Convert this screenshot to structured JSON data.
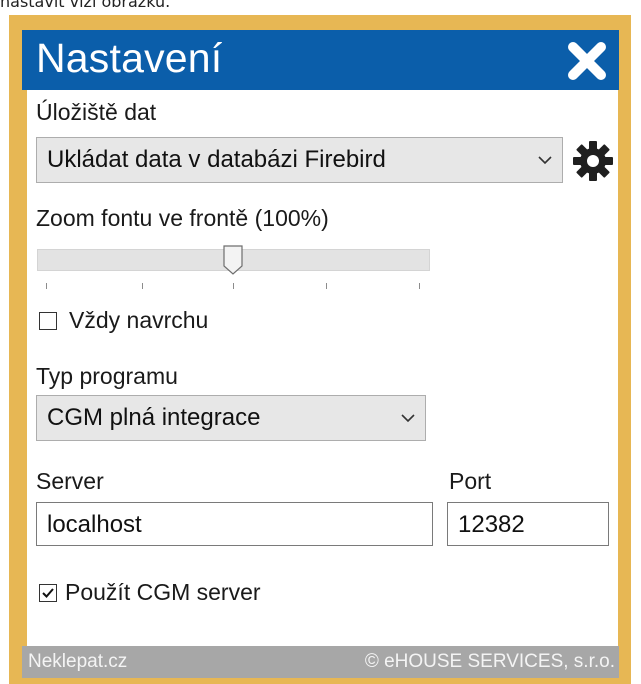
{
  "top_caption": "nastavit vizi obrázku.",
  "window": {
    "title": "Nastavení",
    "close_icon": "close-x-icon",
    "accent_color": "#0b5eaa",
    "frame_color": "#e7b754"
  },
  "storage": {
    "label": "Úložiště dat",
    "selected": "Ukládat data v databázi Firebird",
    "settings_icon": "gear-icon"
  },
  "font_zoom": {
    "label": "Zoom fontu ve frontě (100%)",
    "level_fraction": 0.5
  },
  "always_on_top": {
    "label": "Vždy navrchu",
    "checked": false
  },
  "program_type": {
    "label": "Typ programu",
    "selected": "CGM plná integrace"
  },
  "server": {
    "label": "Server",
    "value": "localhost"
  },
  "port": {
    "label": "Port",
    "value": "12382"
  },
  "use_cgm_server": {
    "label": "Použít CGM server",
    "checked": true
  },
  "footer": {
    "left": "Neklepat.cz",
    "right": "© eHOUSE SERVICES, s.r.o."
  }
}
